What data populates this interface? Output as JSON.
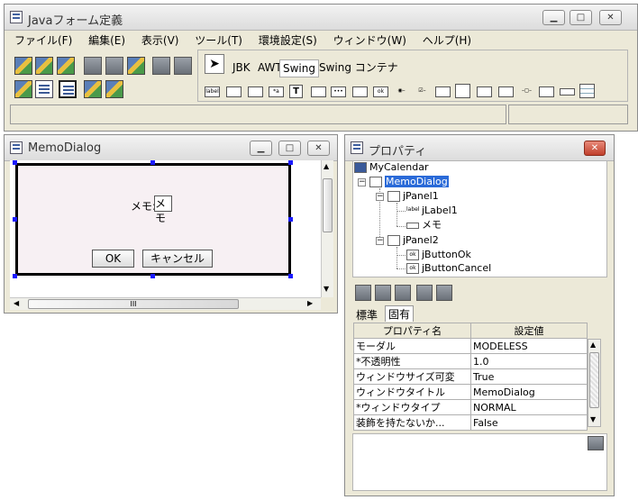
{
  "main_window": {
    "title": "Javaフォーム定義",
    "menu": [
      "ファイル(F)",
      "編集(E)",
      "表示(V)",
      "ツール(T)",
      "環境設定(S)",
      "ウィンドウ(W)",
      "ヘルプ(H)"
    ],
    "palette_tabs": [
      "JBK",
      "AWT",
      "Swing",
      "Swing コンテナ"
    ],
    "palette_active": "Swing"
  },
  "memo_window": {
    "title": "MemoDialog",
    "memo_label": "メモ:",
    "memo_value": "メモ",
    "ok_label": "OK",
    "cancel_label": "キャンセル",
    "hscroll_grip": "III"
  },
  "prop_window": {
    "title": "プロパティ",
    "tree": {
      "root": "MyCalendar",
      "dialog": "MemoDialog",
      "panel1": "jPanel1",
      "label1": "jLabel1",
      "memo": "メモ",
      "panel2": "jPanel2",
      "btn_ok": "jButtonOk",
      "btn_cancel": "jButtonCancel"
    },
    "tabs": [
      "標準",
      "固有"
    ],
    "table_headers": [
      "プロパティ名",
      "設定値"
    ],
    "rows": [
      {
        "name": "モーダル",
        "value": "MODELESS"
      },
      {
        "name": "*不透明性",
        "value": "1.0"
      },
      {
        "name": "ウィンドウサイズ可変",
        "value": "True"
      },
      {
        "name": "ウィンドウタイトル",
        "value": "MemoDialog"
      },
      {
        "name": "*ウィンドウタイプ",
        "value": "NORMAL"
      },
      {
        "name": "装飾を持たないか...",
        "value": "False"
      }
    ]
  }
}
